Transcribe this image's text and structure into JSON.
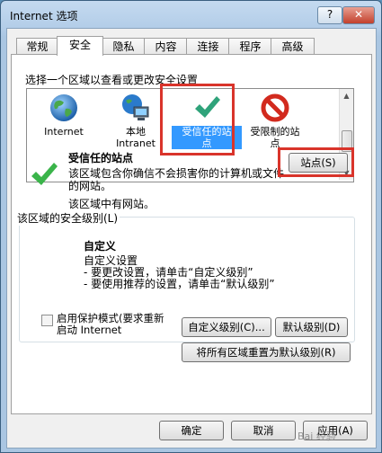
{
  "window": {
    "title": "Internet 选项",
    "help_label": "?",
    "close_label": "✕"
  },
  "tabs": [
    {
      "label": "常规"
    },
    {
      "label": "安全"
    },
    {
      "label": "隐私"
    },
    {
      "label": "内容"
    },
    {
      "label": "连接"
    },
    {
      "label": "程序"
    },
    {
      "label": "高级"
    }
  ],
  "security": {
    "zone_caption": "选择一个区域以查看或更改安全设置",
    "zones": [
      {
        "label": "Internet",
        "icon": "globe-icon"
      },
      {
        "label": "本地\nIntranet",
        "icon": "network-computer-icon"
      },
      {
        "label": "受信任的站\n点",
        "icon": "green-check-icon",
        "selected": true
      },
      {
        "label": "受限制的站\n点",
        "icon": "red-prohibited-icon"
      }
    ],
    "selected_zone": {
      "title": "受信任的站点",
      "description": "该区域包含你确信不会损害你的计算机或文件的网站。",
      "note": "该区域中有网站。",
      "sites_button": "站点(S)"
    },
    "level": {
      "legend": "该区域的安全级别(L)",
      "title": "自定义",
      "description": "自定义设置\n  - 要更改设置，请单击“自定义级别”\n  - 要使用推荐的设置，请单击“默认级别”"
    },
    "protected_mode": {
      "label": "启用保护模式(要求重新\n启动 Internet",
      "checked": false
    },
    "custom_level_button": "自定义级别(C)...",
    "default_level_button": "默认级别(D)",
    "reset_all_button": "将所有区域重置为默认级别(R)"
  },
  "footer": {
    "ok": "确定",
    "cancel": "取消",
    "apply": "应用(A)"
  },
  "watermark": "Bai 经验",
  "colors": {
    "highlight": "#d9342b",
    "selection": "#3399ff"
  }
}
